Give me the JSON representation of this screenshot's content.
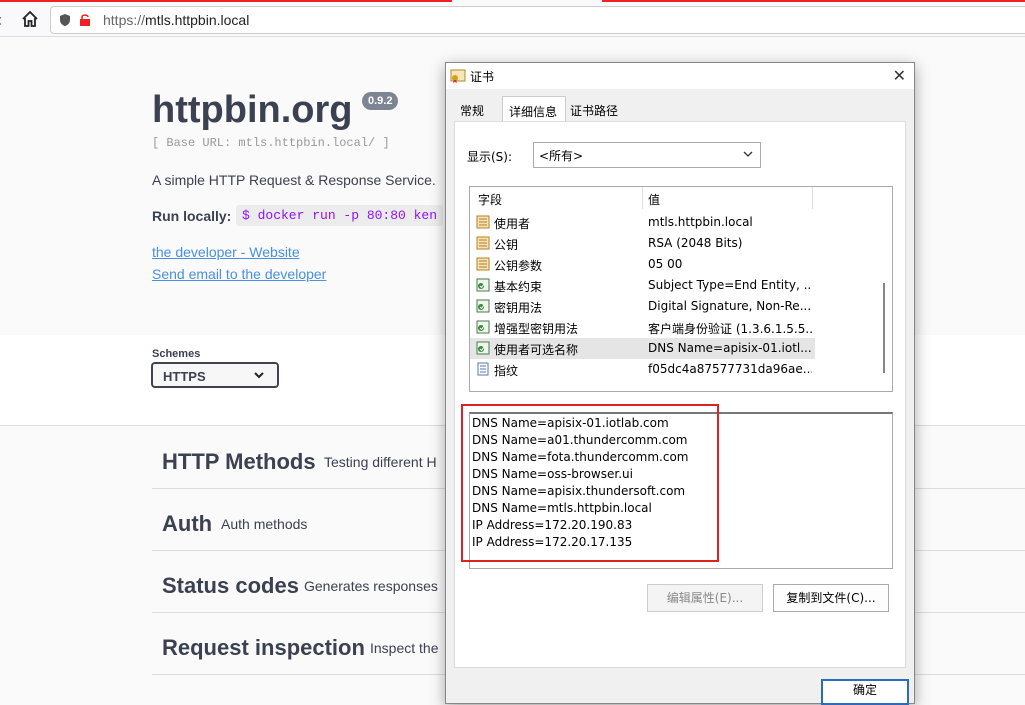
{
  "browser": {
    "url_prefix": "https://",
    "url_host": "mtls.httpbin.local",
    "icons": [
      "home-icon",
      "shield-icon",
      "lock-icon"
    ]
  },
  "page": {
    "title": "httpbin.org",
    "version": "0.9.2",
    "base_url": "[ Base URL: mtls.httpbin.local/ ]",
    "description": "A simple HTTP Request & Response Service.",
    "run_locally_label": "Run locally:",
    "run_command": "$ docker run -p 80:80 ken",
    "link_website": "the developer - Website",
    "link_email": "Send email to the developer",
    "schemes_label": "Schemes",
    "scheme_value": "HTTPS",
    "sections": [
      {
        "heading": "HTTP Methods",
        "desc": "Testing different H"
      },
      {
        "heading": "Auth",
        "desc": "Auth methods"
      },
      {
        "heading": "Status codes",
        "desc": "Generates responses"
      },
      {
        "heading": "Request inspection",
        "desc": "Inspect the"
      }
    ]
  },
  "dialog": {
    "title": "证书",
    "tabs": [
      "常规",
      "详细信息",
      "证书路径"
    ],
    "active_tab": "详细信息",
    "show_label": "显示(S):",
    "show_value": "<所有>",
    "col_field": "字段",
    "col_value": "值",
    "rows": [
      {
        "field": "使用者",
        "value": "mtls.httpbin.local",
        "icon": "property-icon"
      },
      {
        "field": "公钥",
        "value": "RSA (2048 Bits)",
        "icon": "property-icon"
      },
      {
        "field": "公钥参数",
        "value": "05 00",
        "icon": "property-icon"
      },
      {
        "field": "基本约束",
        "value": "Subject Type=End Entity, ...",
        "icon": "extension-icon"
      },
      {
        "field": "密钥用法",
        "value": "Digital Signature, Non-Re...",
        "icon": "extension-icon"
      },
      {
        "field": "增强型密钥用法",
        "value": "客户端身份验证 (1.3.6.1.5.5....",
        "icon": "extension-icon"
      },
      {
        "field": "使用者可选名称",
        "value": "DNS Name=apisix-01.iotl...",
        "icon": "extension-icon",
        "selected": true
      },
      {
        "field": "指纹",
        "value": "f05dc4a87577731da96ae...",
        "icon": "document-icon"
      }
    ],
    "detail_lines": [
      "DNS Name=apisix-01.iotlab.com",
      "DNS Name=a01.thundercomm.com",
      "DNS Name=fota.thundercomm.com",
      "DNS Name=oss-browser.ui",
      "DNS Name=apisix.thundersoft.com",
      "DNS Name=mtls.httpbin.local",
      "IP Address=172.20.190.83",
      "IP Address=172.20.17.135"
    ],
    "btn_edit": "编辑属性(E)...",
    "btn_copy": "复制到文件(C)...",
    "btn_ok": "确定",
    "highlight_color": "#dd2222"
  }
}
